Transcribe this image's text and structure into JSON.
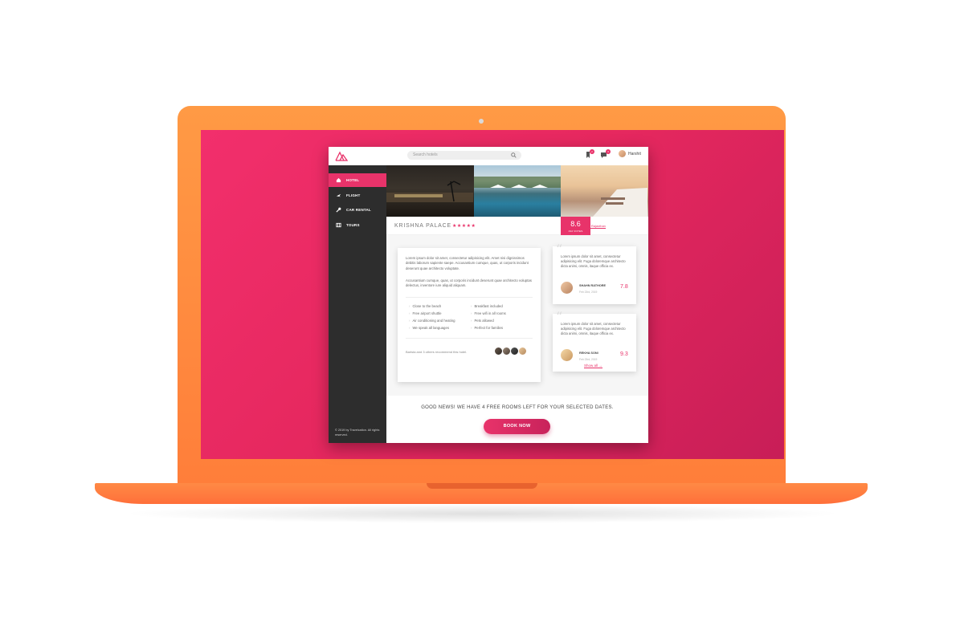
{
  "search": {
    "placeholder": "Search hotels"
  },
  "user": {
    "name": "Harshit"
  },
  "topbar": {
    "cart_badge": "2",
    "messages_badge": "3"
  },
  "sidebar": {
    "items": [
      {
        "label": "HOTEL",
        "icon": "home-icon",
        "active": true
      },
      {
        "label": "FLIGHT",
        "icon": "plane-icon",
        "active": false
      },
      {
        "label": "CAR RENTAL",
        "icon": "wrench-icon",
        "active": false
      },
      {
        "label": "TOURS",
        "icon": "map-icon",
        "active": false
      }
    ],
    "copyright": "© 2019 by Travelcation. All rights reserved."
  },
  "hotel": {
    "name": "KRISHNA PALACE",
    "stars": "★★★★★",
    "location": "Pali, Rajasthan",
    "score": "8.6",
    "score_label": "432 VOTES"
  },
  "description": {
    "para1": "Lorem ipsum dolor sit amet, consectetur adipisicing elit. Amet nisi dignissimos debitis laborum sapiente saepe. Accusantium cumque, quas, ut corporis incidunt deserunt quae architecto voluptate.",
    "para2": "Accusantium cumque, quas, ut corporis incidunt deserunt quae architecto voluptas delectus, inventore iure aliquid aliquam.",
    "amenities_left": [
      "Close to the beach",
      "Free airport shuttle",
      "Air conditioning and heating",
      "We speak all languages"
    ],
    "amenities_right": [
      "Breakfast included",
      "Free wifi in all rooms",
      "Pets allowed",
      "Perfect for families"
    ],
    "recommend": "Barista and 3 others recommend this hotel."
  },
  "reviews": [
    {
      "text": "Lorem ipsum dolor sit amet, consectetur adipisicing elit. Fuga doloremque architecto dicta animi, omnis, itaque officia ex.",
      "name": "SHAHN RATHORE",
      "date": "Feb 23rd, 2019",
      "score": "7.8"
    },
    {
      "text": "Lorem ipsum dolor sit amet, consectetur adipisicing elit. Fuga doloremque architecto dicta animi, omnis, itaque officia ex.",
      "name": "REKHA SONI",
      "date": "Feb 23rd, 2019",
      "score": "9.3"
    }
  ],
  "show_all": "Show all →",
  "availability": "GOOD NEWS! WE HAVE 4 FREE ROOMS LEFT FOR YOUR SELECTED DATES.",
  "book_now": "BOOK NOW",
  "colors": {
    "accent": "#e8336a",
    "sidebar": "#2d2d2d",
    "laptop": "#ff8a45"
  }
}
